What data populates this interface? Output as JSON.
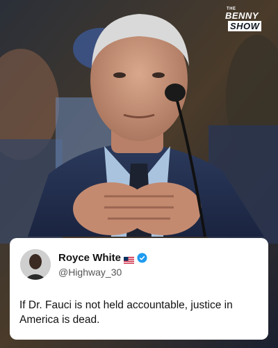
{
  "brand": {
    "the": "THE",
    "name_top": "BENNY",
    "name_bottom": "SHOW"
  },
  "tweet": {
    "author_name": "Royce White",
    "handle": "@Highway_30",
    "text": "If Dr. Fauci is not held accountable, justice in America is dead."
  },
  "colors": {
    "background": "#0d1420",
    "card": "#ffffff",
    "verified": "#1d9bf0"
  },
  "icons": {
    "flag": "us-flag-icon",
    "verified": "verified-badge-icon"
  }
}
